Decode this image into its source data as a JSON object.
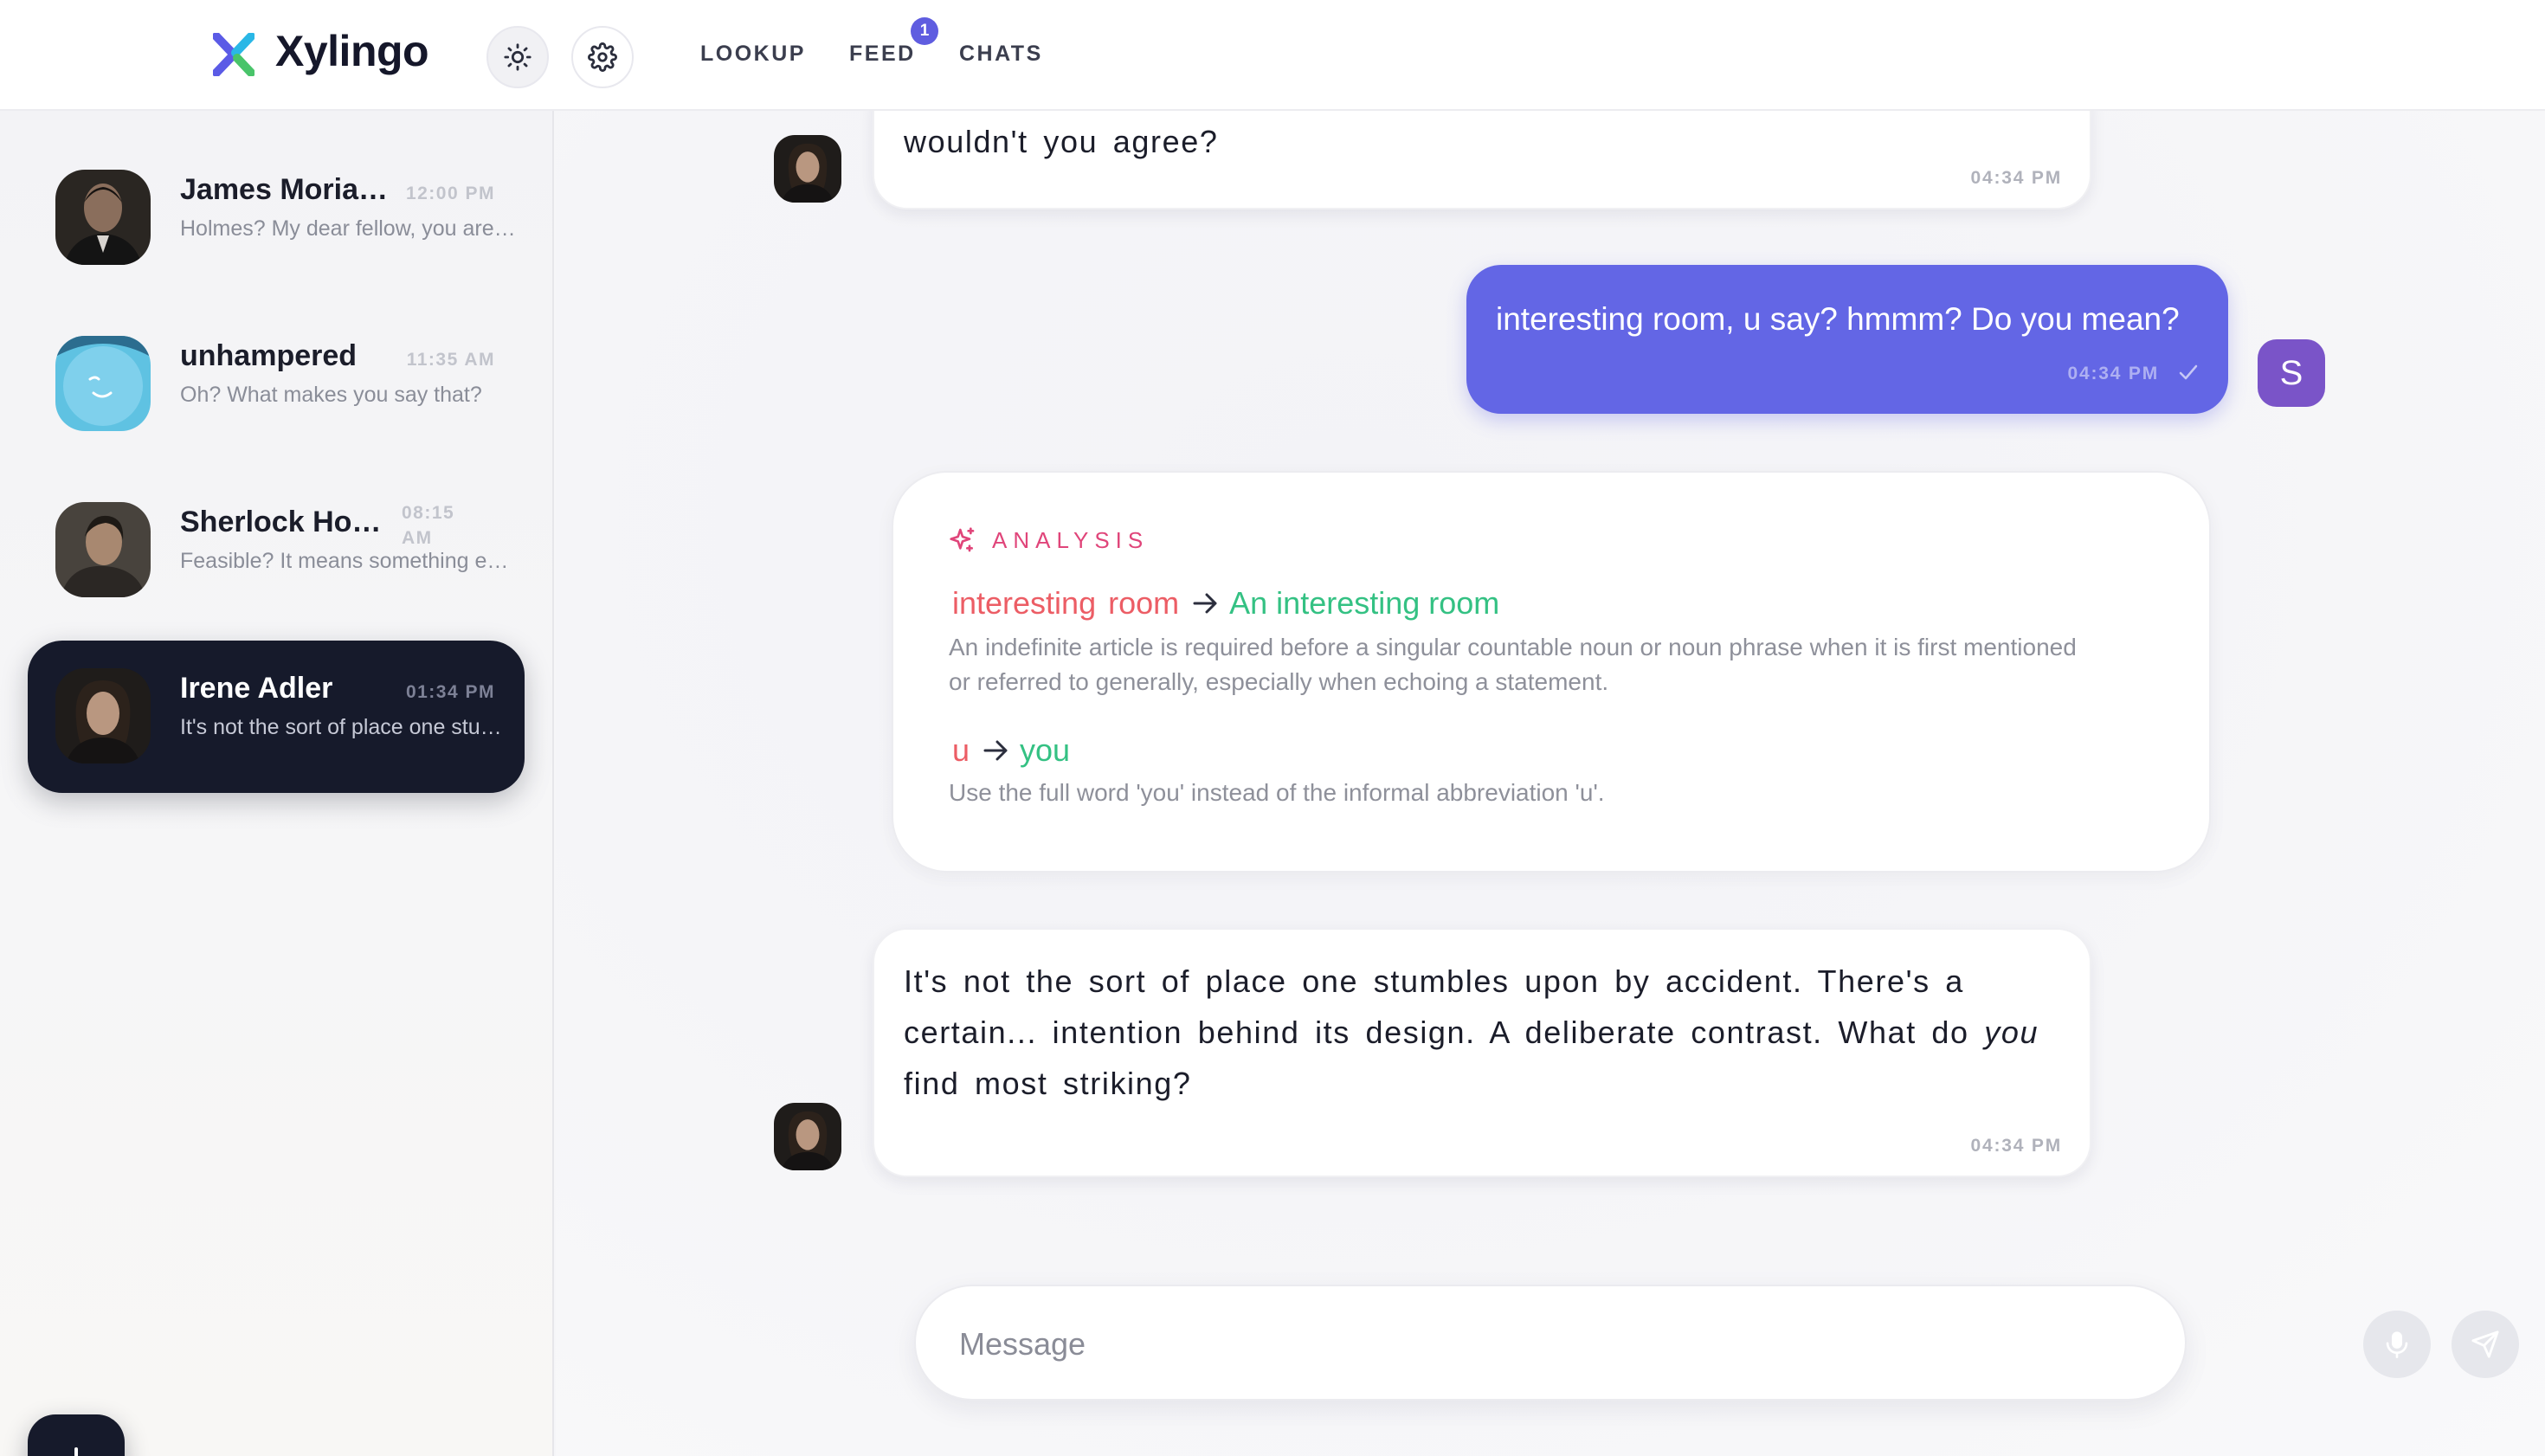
{
  "app": {
    "brand": "Xylingo",
    "accent_color": "#6366e5",
    "logo_colors": [
      "#5b5be6",
      "#2ab7e6",
      "#49c46a"
    ]
  },
  "header": {
    "theme_icon": "sun-icon",
    "settings_icon": "gear-icon",
    "nav": {
      "lookup": "LOOKUP",
      "feed": "FEED",
      "chats": "CHATS"
    },
    "feed_badge": "1"
  },
  "sidebar": {
    "chats": [
      {
        "name": "James Moriarty",
        "time": "12:00 PM",
        "preview": "Holmes? My dear fellow, you are quite mistaken.",
        "active": false
      },
      {
        "name": "unhampered",
        "time": "11:35 AM",
        "preview": "Oh? What makes you say that?",
        "active": false
      },
      {
        "name": "Sherlock Holmes",
        "time": "08:15 AM",
        "time_line1": "08:15",
        "time_line2": "AM",
        "preview": "Feasible? It means something entirely different.",
        "active": false
      },
      {
        "name": "Irene Adler",
        "time": "01:34 PM",
        "preview": "It's not the sort of place one stumbles upon by accident.",
        "active": true
      }
    ],
    "new_chat_icon": "plus-icon"
  },
  "messages": {
    "top_partial": {
      "text": "wouldn't you agree?",
      "time": "04:34 PM"
    },
    "outgoing": {
      "text": "interesting room, u say? hmmm? Do you mean?",
      "time": "04:34 PM",
      "status_icon": "check-icon",
      "avatar_letter": "S"
    },
    "analysis": {
      "title": "ANALYSIS",
      "icon": "sparkle-icon",
      "corrections": [
        {
          "wrong_words": [
            "interesting",
            "room"
          ],
          "right": "An interesting room",
          "explanation": "An indefinite article is required before a singular countable noun or noun phrase when it is first mentioned or referred to generally, especially when echoing a statement."
        },
        {
          "wrong_words": [
            "u"
          ],
          "right": "you",
          "explanation": "Use the full word 'you' instead of the informal abbreviation 'u'."
        }
      ]
    },
    "last_incoming": {
      "text_before": "It's not the sort of place one stumbles upon by accident. There's a certain... intention behind its design. A deliberate contrast. What do ",
      "text_emphasis": "you",
      "text_after": " find most striking?",
      "time": "04:34 PM"
    }
  },
  "composer": {
    "placeholder": "Message",
    "value": "",
    "mic_icon": "mic-icon",
    "send_icon": "send-icon"
  }
}
